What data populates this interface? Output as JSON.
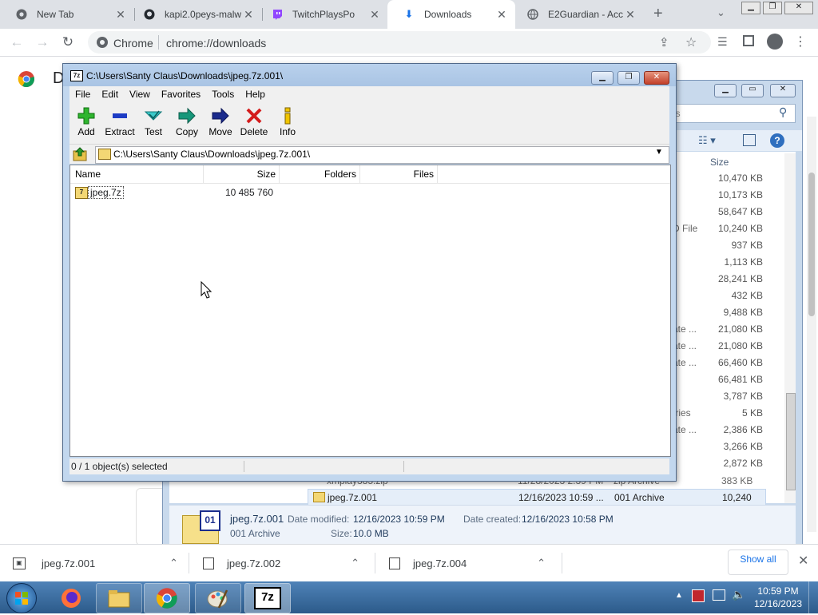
{
  "browser": {
    "tabs": [
      {
        "title": "New Tab",
        "icon": "chrome-icon"
      },
      {
        "title": "kapi2.0peys-malw",
        "icon": "github-icon"
      },
      {
        "title": "TwitchPlaysPo",
        "icon": "twitch-icon"
      },
      {
        "title": "Downloads",
        "icon": "download-icon"
      },
      {
        "title": "E2Guardian - Acc",
        "icon": "globe-icon"
      }
    ],
    "omnibox": {
      "scheme_label": "Chrome",
      "url": "chrome://downloads"
    },
    "page_title_initial": "D"
  },
  "explorer": {
    "search_placeholder": "ds",
    "size_header": "Size",
    "sizes": [
      "10,470 KB",
      "10,173 KB",
      "58,647 KB",
      "10,240 KB",
      "937 KB",
      "1,113 KB",
      "28,241 KB",
      "432 KB",
      "9,488 KB",
      "21,080 KB",
      "21,080 KB",
      "66,460 KB",
      "66,481 KB",
      "3,787 KB",
      "5 KB",
      "2,386 KB",
      "3,266 KB",
      "2,872 KB",
      "383 KB",
      "10,240 KB"
    ],
    "type_fragments": [
      "",
      "",
      "",
      "D File",
      "",
      "",
      "",
      "",
      "",
      "ate ...",
      "ate ...",
      "ate ...",
      "",
      "",
      "tries",
      "ate ...",
      "",
      "",
      "",
      ""
    ],
    "partial_row": {
      "name": "xmplay385.zip",
      "date": "11/28/2023 2:39 PM",
      "type": "zip Archive"
    },
    "selected_row": {
      "name": "jpeg.7z.001",
      "date": "12/16/2023 10:59 ...",
      "type": "001 Archive",
      "size": "10,240 KB"
    },
    "details": {
      "name": "jpeg.7z.001",
      "type": "001 Archive",
      "date_modified_label": "Date modified:",
      "date_modified": "12/16/2023 10:59 PM",
      "date_created_label": "Date created:",
      "date_created": "12/16/2023 10:58 PM",
      "size_label": "Size:",
      "size": "10.0 MB",
      "icon_text": "01"
    }
  },
  "sevenzip": {
    "title": "C:\\Users\\Santy Claus\\Downloads\\jpeg.7z.001\\",
    "menu": [
      "File",
      "Edit",
      "View",
      "Favorites",
      "Tools",
      "Help"
    ],
    "toolbar": [
      {
        "label": "Add",
        "icon": "add-icon",
        "color": "#1fa31f"
      },
      {
        "label": "Extract",
        "icon": "extract-icon",
        "color": "#1d3cc4"
      },
      {
        "label": "Test",
        "icon": "test-icon",
        "color": "#19b3b3"
      },
      {
        "label": "Copy",
        "icon": "copy-icon",
        "color": "#17977a"
      },
      {
        "label": "Move",
        "icon": "move-icon",
        "color": "#1a2a8c"
      },
      {
        "label": "Delete",
        "icon": "delete-icon",
        "color": "#d41c1c"
      },
      {
        "label": "Info",
        "icon": "info-icon",
        "color": "#c9a200"
      }
    ],
    "address": "C:\\Users\\Santy Claus\\Downloads\\jpeg.7z.001\\",
    "columns": [
      "Name",
      "Size",
      "Folders",
      "Files"
    ],
    "rows": [
      {
        "name": "jpeg.7z",
        "size": "10 485 760",
        "folders": "",
        "files": ""
      }
    ],
    "status": "0 / 1 object(s) selected"
  },
  "shelf": {
    "items": [
      {
        "name": "jpeg.7z.001"
      },
      {
        "name": "jpeg.7z.002"
      },
      {
        "name": "jpeg.7z.004"
      }
    ],
    "show_all": "Show all"
  },
  "taskbar": {
    "apps": [
      "windows-start",
      "firefox",
      "file-explorer",
      "chrome",
      "paint",
      "7zip"
    ],
    "app_7z_label": "7z",
    "time": "10:59 PM",
    "date": "12/16/2023"
  }
}
